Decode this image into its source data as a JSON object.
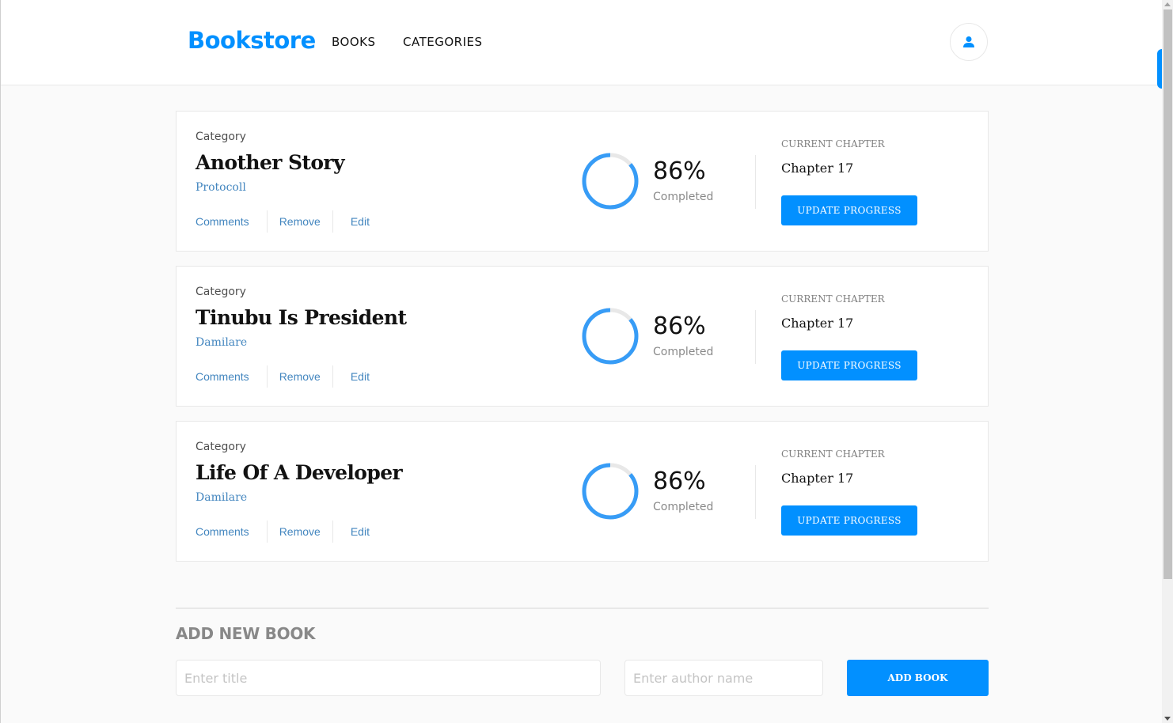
{
  "header": {
    "logo": "Bookstore",
    "nav": [
      "BOOKS",
      "CATEGORIES"
    ],
    "user_icon": "user-icon"
  },
  "books": [
    {
      "category": "Category",
      "title": "Another Story",
      "author": "Protocoll",
      "actions": [
        "Comments",
        "Remove",
        "Edit"
      ],
      "progress_percent": 86,
      "progress_text": "86%",
      "completed_label": "Completed",
      "chapter_label": "CURRENT CHAPTER",
      "chapter": "Chapter 17",
      "update_button": "UPDATE PROGRESS"
    },
    {
      "category": "Category",
      "title": "Tinubu Is President",
      "author": "Damilare",
      "actions": [
        "Comments",
        "Remove",
        "Edit"
      ],
      "progress_percent": 86,
      "progress_text": "86%",
      "completed_label": "Completed",
      "chapter_label": "CURRENT CHAPTER",
      "chapter": "Chapter 17",
      "update_button": "UPDATE PROGRESS"
    },
    {
      "category": "Category",
      "title": "Life Of A Developer",
      "author": "Damilare",
      "actions": [
        "Comments",
        "Remove",
        "Edit"
      ],
      "progress_percent": 86,
      "progress_text": "86%",
      "completed_label": "Completed",
      "chapter_label": "CURRENT CHAPTER",
      "chapter": "Chapter 17",
      "update_button": "UPDATE PROGRESS"
    }
  ],
  "form": {
    "title": "ADD NEW BOOK",
    "title_placeholder": "Enter title",
    "author_placeholder": "Enter author name",
    "submit": "ADD BOOK"
  },
  "colors": {
    "accent": "#0290ff",
    "link": "#4386bf",
    "progress": "#379cf6",
    "track": "#e8e8e8"
  }
}
